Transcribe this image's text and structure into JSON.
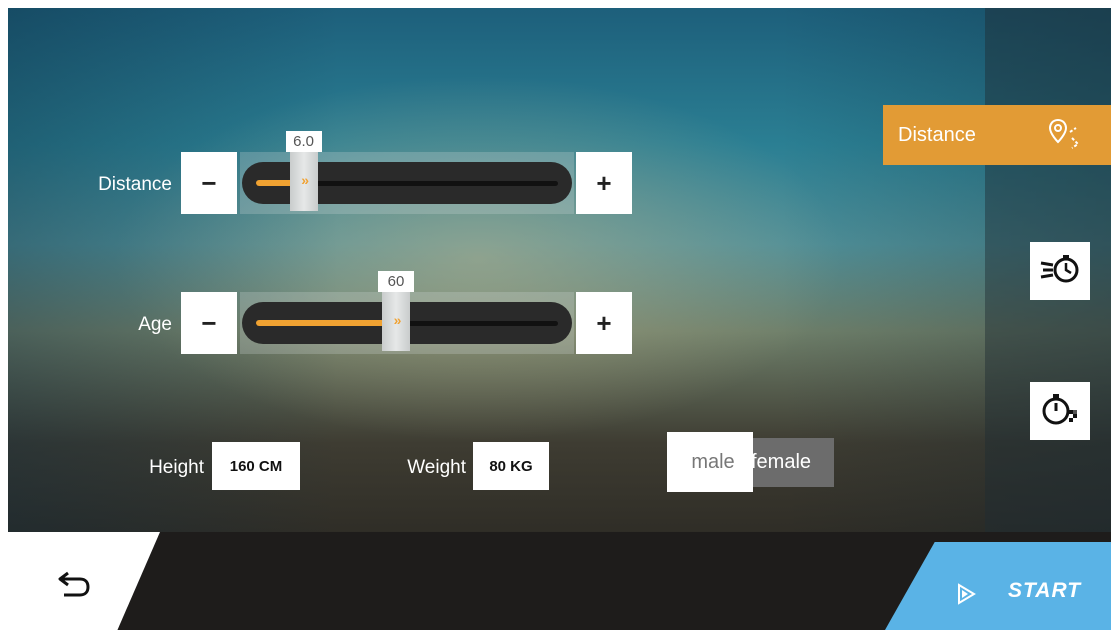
{
  "controls": {
    "distance": {
      "label": "Distance",
      "value": "6.0",
      "minus": "−",
      "plus": "+",
      "fraction": 0.17
    },
    "age": {
      "label": "Age",
      "value": "60",
      "minus": "−",
      "plus": "+",
      "fraction": 0.5
    }
  },
  "height": {
    "label": "Height",
    "value": "160 CM"
  },
  "weight": {
    "label": "Weight",
    "value": "80 KG"
  },
  "gender": {
    "options": [
      "male",
      "female"
    ],
    "selected": "male"
  },
  "sidebar": {
    "active_tab": "Distance",
    "icons": [
      "route-pin-icon",
      "speed-timer-icon",
      "stopwatch-flag-icon"
    ]
  },
  "footer": {
    "start_label": "START"
  },
  "colors": {
    "accent": "#e29b35",
    "start": "#5ab3e6",
    "fill": "#f0a232"
  }
}
